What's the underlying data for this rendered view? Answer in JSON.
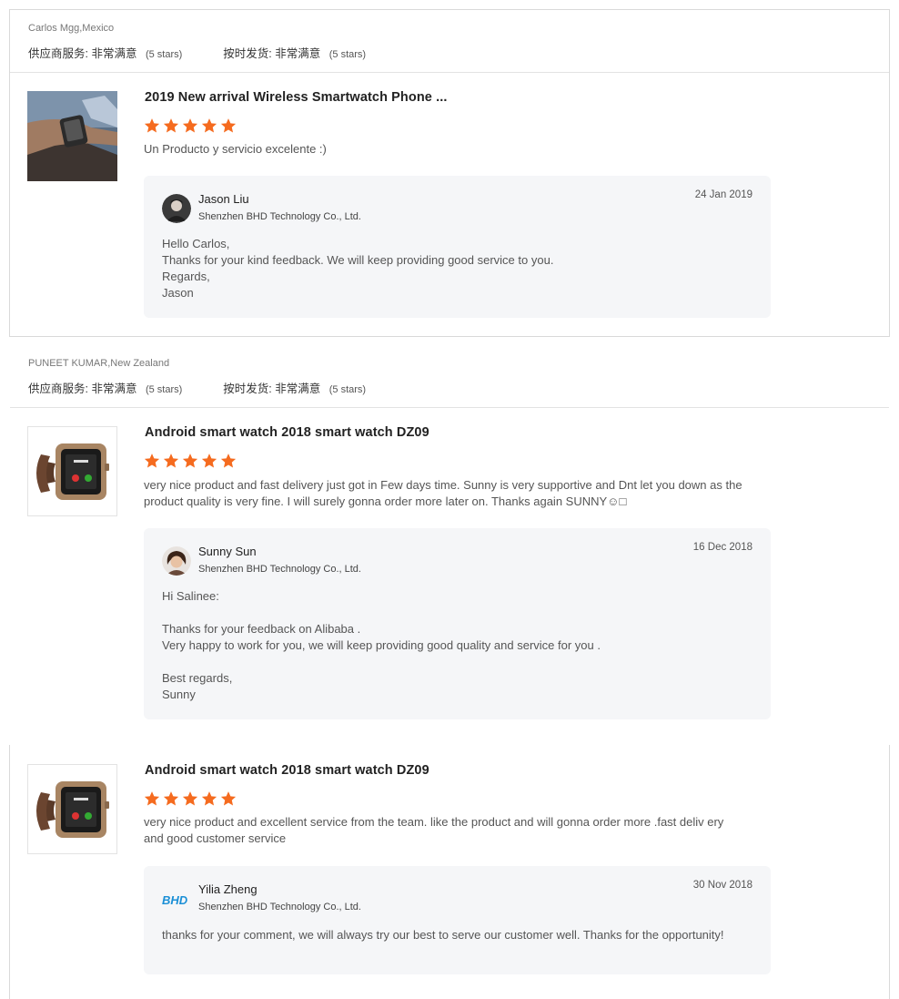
{
  "reviews": [
    {
      "reviewer": "Carlos Mgg,Mexico",
      "supplier_service_label": "供应商服务:",
      "supplier_service_value": "非常满意",
      "supplier_service_stars": "(5 stars)",
      "ontime_label": "按时发货:",
      "ontime_value": "非常满意",
      "ontime_stars": "(5 stars)",
      "product_image_icon": "smartwatch-on-wrist-photo",
      "product_title": "2019 New arrival Wireless Smartwatch Phone ...",
      "rating": 5,
      "comment": "Un Producto y servicio excelente :)",
      "reply": {
        "avatar_icon": "man-avatar",
        "name": "Jason Liu",
        "company": "Shenzhen BHD Technology Co., Ltd.",
        "date": "24 Jan 2019",
        "lines": [
          "Hello Carlos,",
          "Thanks for your kind feedback. We will keep providing good service to you.",
          "Regards,",
          "Jason"
        ]
      }
    },
    {
      "reviewer": "PUNEET KUMAR,New Zealand",
      "supplier_service_label": "供应商服务:",
      "supplier_service_value": "非常满意",
      "supplier_service_stars": "(5 stars)",
      "ontime_label": "按时发货:",
      "ontime_value": "非常满意",
      "ontime_stars": "(5 stars)",
      "product_image_icon": "smartwatch-brown-strap",
      "product_title": "Android smart watch 2018 smart watch DZ09",
      "rating": 5,
      "comment": "very nice product and fast delivery just got in Few days time. Sunny is very supportive and Dnt let you down as the product quality is very fine. I will surely gonna order more later on. Thanks again SUNNY☺□",
      "reply": {
        "avatar_icon": "woman-avatar",
        "name": "Sunny Sun",
        "company": "Shenzhen BHD Technology Co., Ltd.",
        "date": "16 Dec 2018",
        "lines": [
          "Hi Salinee:",
          "",
          "Thanks for your feedback on Alibaba .",
          "Very happy to work for you,  we will keep providing good quality and service for you .",
          "",
          "Best regards,",
          "Sunny"
        ]
      }
    },
    {
      "product_image_icon": "smartwatch-brown-strap",
      "product_title": "Android smart watch 2018 smart watch DZ09",
      "rating": 5,
      "comment": "very nice product and excellent service from the team. like the product and will gonna order more .fast deliv ery and good customer service",
      "reply": {
        "avatar_icon": "bhd-logo",
        "avatar_logo_text": "BHD",
        "name": "Yilia Zheng",
        "company": "Shenzhen BHD Technology Co., Ltd.",
        "date": "30 Nov 2018",
        "lines": [
          "thanks for your comment, we will always try our best to serve our customer well. Thanks for the opportunity!"
        ]
      }
    }
  ],
  "colors": {
    "star": "#f56b1f",
    "reply_bg": "#f5f6f8",
    "border": "#d9d9d9"
  }
}
